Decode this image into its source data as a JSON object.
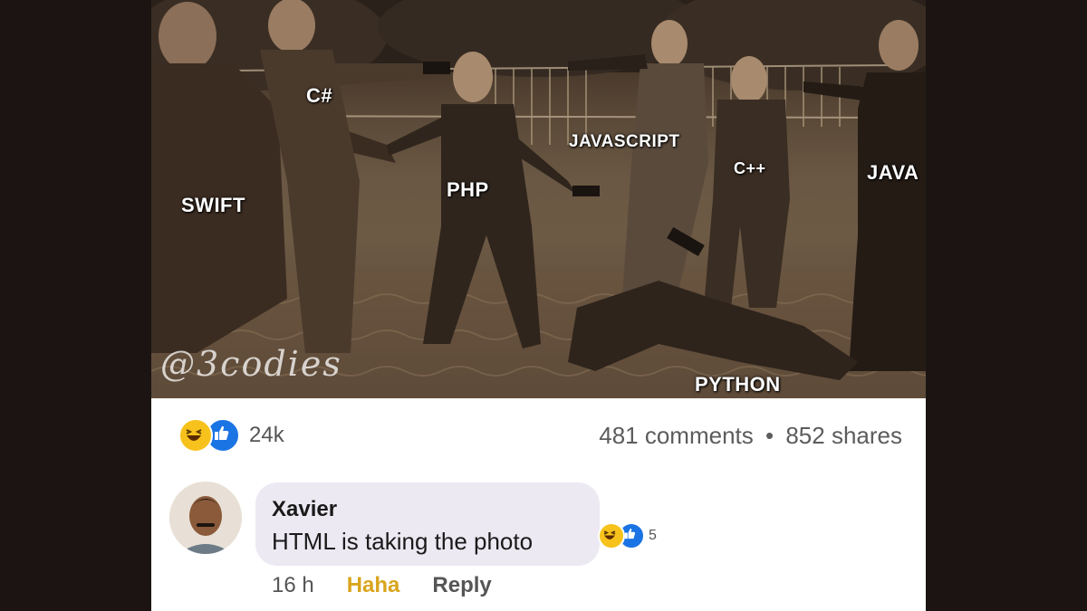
{
  "meme": {
    "labels": {
      "swift": "SWIFT",
      "csharp": "C#",
      "php": "PHP",
      "javascript": "JAVASCRIPT",
      "cpp": "C++",
      "java": "JAVA",
      "python": "PYTHON"
    },
    "watermark": "@3codies"
  },
  "post": {
    "reaction_icons": [
      "haha-icon",
      "like-icon"
    ],
    "reaction_count": "24k",
    "comments": "481 comments",
    "separator": "•",
    "shares": "852 shares"
  },
  "comment": {
    "author": "Xavier",
    "text": "HTML is taking the photo",
    "reaction_icons": [
      "haha-icon",
      "like-icon"
    ],
    "reaction_count": "5",
    "time": "16 h",
    "haha_label": "Haha",
    "reply_label": "Reply"
  },
  "colors": {
    "photo_tone": "#6a5844",
    "haha": "#f7c21b",
    "like": "#1b74e4",
    "haha_link": "#d9a51c",
    "bubble": "#ece9f2"
  }
}
